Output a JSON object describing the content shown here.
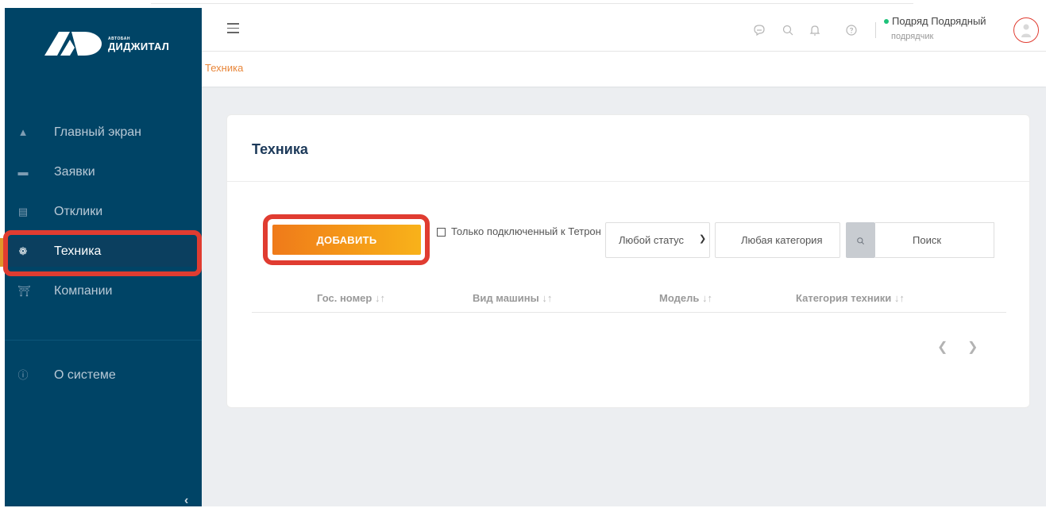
{
  "logo": {
    "small": "АВТОБАН",
    "big": "ДИДЖИТАЛ"
  },
  "sidebar": {
    "items": [
      {
        "label": "Главный экран",
        "icon": "home-icon"
      },
      {
        "label": "Заявки",
        "icon": "ticket-icon"
      },
      {
        "label": "Отклики",
        "icon": "document-icon"
      },
      {
        "label": "Техника",
        "icon": "wheel-icon",
        "active": true
      },
      {
        "label": "Компании",
        "icon": "bank-icon"
      }
    ],
    "about": {
      "label": "О системе",
      "icon": "info-icon"
    },
    "collapse": "‹"
  },
  "header": {
    "user_name": "Подряд Подрядный",
    "user_role": "подрядчик",
    "status_color": "#1ec27a"
  },
  "breadcrumb": "Техника",
  "card": {
    "title": "Техника",
    "add_button": "ДОБАВИТЬ",
    "checkbox_label": "Только подключенный к Тетрон",
    "status_select": "Любой статус",
    "category_placeholder": "Любая категория",
    "search_placeholder": "Поиск",
    "columns": [
      "Гос. номер",
      "Вид машины",
      "Модель",
      "Категория техники"
    ],
    "sort_glyph": "↓↑"
  },
  "colors": {
    "sidebar": "#004466",
    "accent": "#f59a18",
    "highlight": "#e03c31",
    "breadcrumb": "#e8863a"
  }
}
